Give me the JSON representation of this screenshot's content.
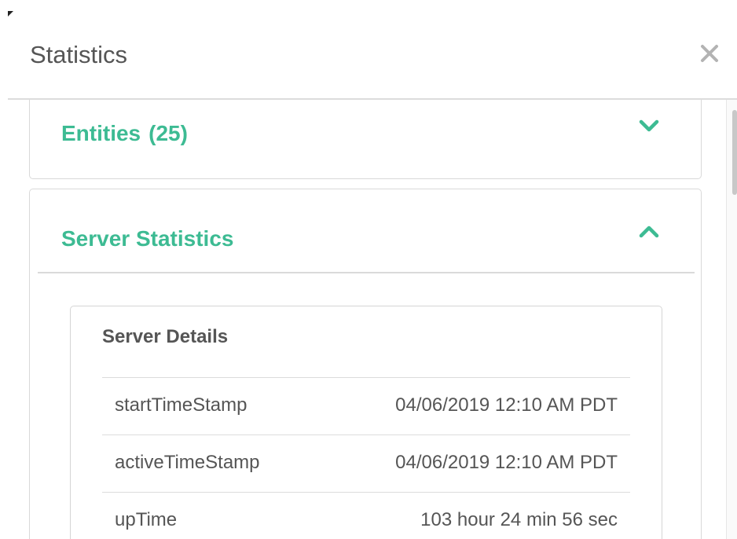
{
  "dialog": {
    "title": "Statistics",
    "close_icon": "close-icon"
  },
  "colors": {
    "accent": "#3dbb93",
    "text": "#555555",
    "border": "#d9d9d9"
  },
  "panels": {
    "entities": {
      "title": "Entities",
      "count": "(25)",
      "icon": "chevron-down-icon",
      "expanded": false
    },
    "server_statistics": {
      "title": "Server Statistics",
      "icon": "chevron-up-icon",
      "expanded": true,
      "details": {
        "title": "Server Details",
        "rows": [
          {
            "key": "startTimeStamp",
            "value": "04/06/2019 12:10 AM PDT"
          },
          {
            "key": "activeTimeStamp",
            "value": "04/06/2019 12:10 AM PDT"
          },
          {
            "key": "upTime",
            "value": "103 hour 24 min 56 sec"
          }
        ]
      }
    }
  }
}
